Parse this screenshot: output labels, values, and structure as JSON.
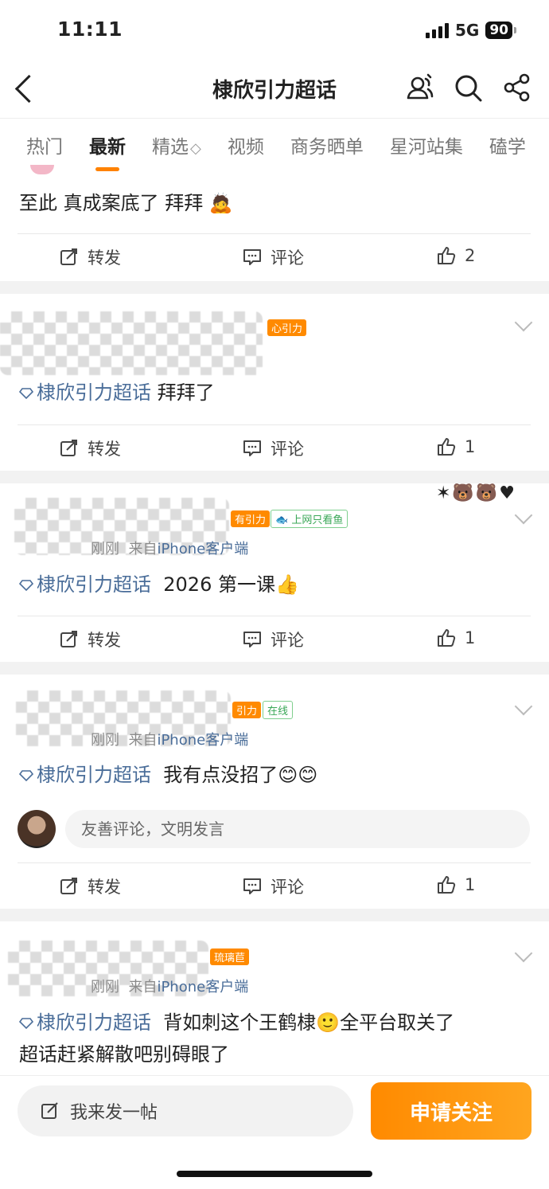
{
  "status_bar": {
    "time": "11:11",
    "network": "5G",
    "battery": "90"
  },
  "nav": {
    "title": "棣欣引力超话"
  },
  "tabs": [
    {
      "label": "热门",
      "active": false
    },
    {
      "label": "最新",
      "active": true
    },
    {
      "label": "精选",
      "active": false
    },
    {
      "label": "视频",
      "active": false
    },
    {
      "label": "商务晒单",
      "active": false
    },
    {
      "label": "星河站集",
      "active": false
    },
    {
      "label": "磕学",
      "active": false
    }
  ],
  "actions": {
    "repost": "转发",
    "comment": "评论"
  },
  "posts": [
    {
      "text": "至此 真成案底了 拜拜",
      "likes": "2"
    },
    {
      "topic": "棣欣引力超话",
      "text": "拜拜了",
      "badge": "心引力",
      "likes": "1"
    },
    {
      "topic": "棣欣引力超话",
      "text": "2026 第一课",
      "badge": "有引力",
      "badge2": "上网只看鱼",
      "meta_time": "刚刚",
      "meta_from": "来自",
      "meta_src": "iPhone客户端",
      "likes": "1"
    },
    {
      "topic": "棣欣引力超话",
      "text": "我有点没招了",
      "badge": "引力",
      "badge2": "在线",
      "meta_time": "刚刚",
      "meta_from": "来自",
      "meta_src": "iPhone客户端",
      "comment_placeholder": "友善评论，文明发言",
      "likes": "1"
    },
    {
      "topic": "棣欣引力超话",
      "text": "背如刺这个王鹤棣",
      "text2": "全平台取关了",
      "line2": "超话赶紧解散吧别碍眼了",
      "badge": "琉璃苣",
      "meta_time": "刚刚",
      "meta_from": "来自",
      "meta_src": "iPhone客户端"
    }
  ],
  "bottom": {
    "post_placeholder": "我来发一帖",
    "follow_label": "申请关注"
  },
  "colors": {
    "accent": "#ff8200",
    "topic": "#4a6d99"
  }
}
